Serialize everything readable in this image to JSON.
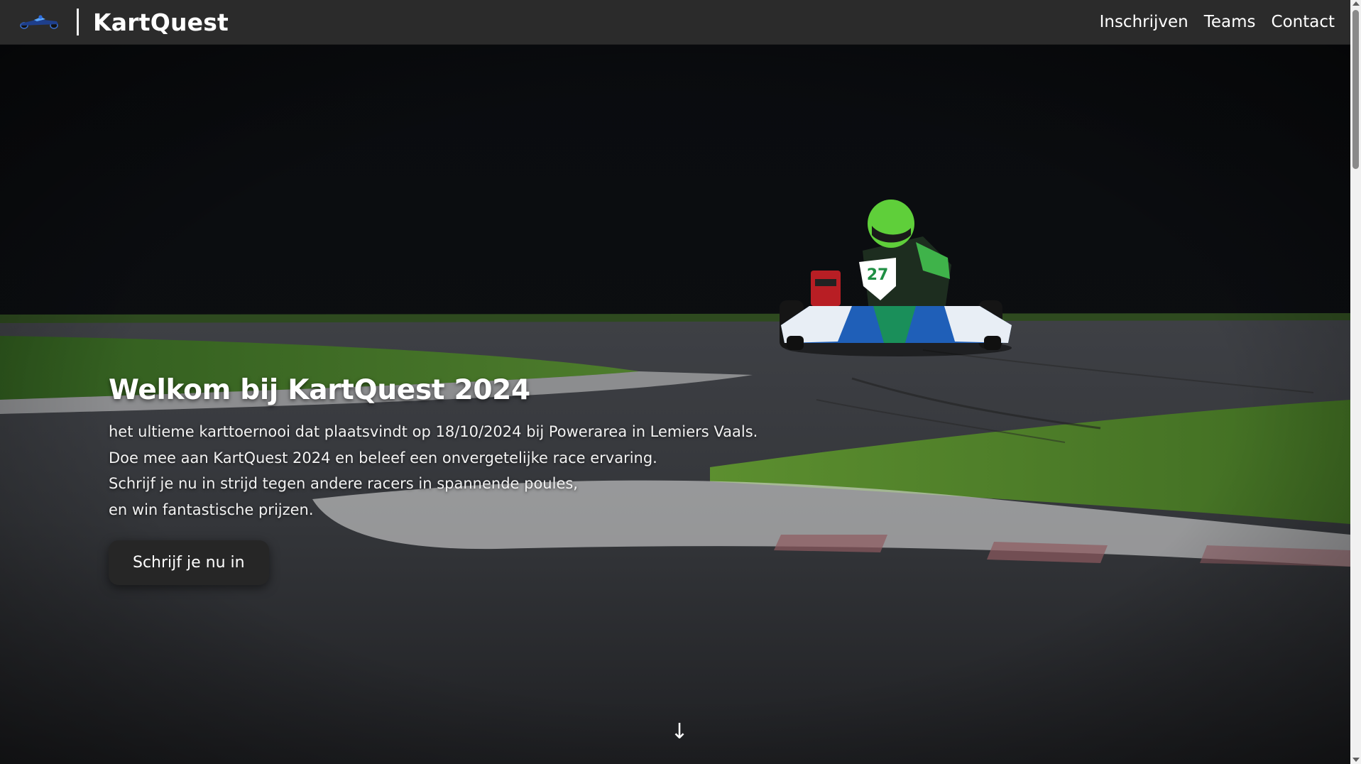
{
  "navbar": {
    "brand_name": "KartQuest",
    "logo_icon": "kart-icon",
    "links": [
      {
        "label": "Inschrijven"
      },
      {
        "label": "Teams"
      },
      {
        "label": "Contact"
      }
    ]
  },
  "hero": {
    "title": "Welkom bij KartQuest 2024",
    "lines": [
      "het ultieme karttoernooi dat plaatsvindt op 18/10/2024 bij Powerarea in Lemiers Vaals.",
      "Doe mee aan KartQuest 2024 en beleef een onvergetelijke race ervaring.",
      "Schrijf je nu in strijd tegen andere racers in spannende poules,",
      "en win fantastische prijzen."
    ],
    "cta_label": "Schrijf je nu in",
    "kart_number": "27",
    "scroll_icon": "arrow-down-icon"
  },
  "colors": {
    "navbar_bg": "#2b2b2b",
    "button_bg": "#262626",
    "helmet_green": "#5fcf3a",
    "kart_blue": "#1f5fb8"
  }
}
